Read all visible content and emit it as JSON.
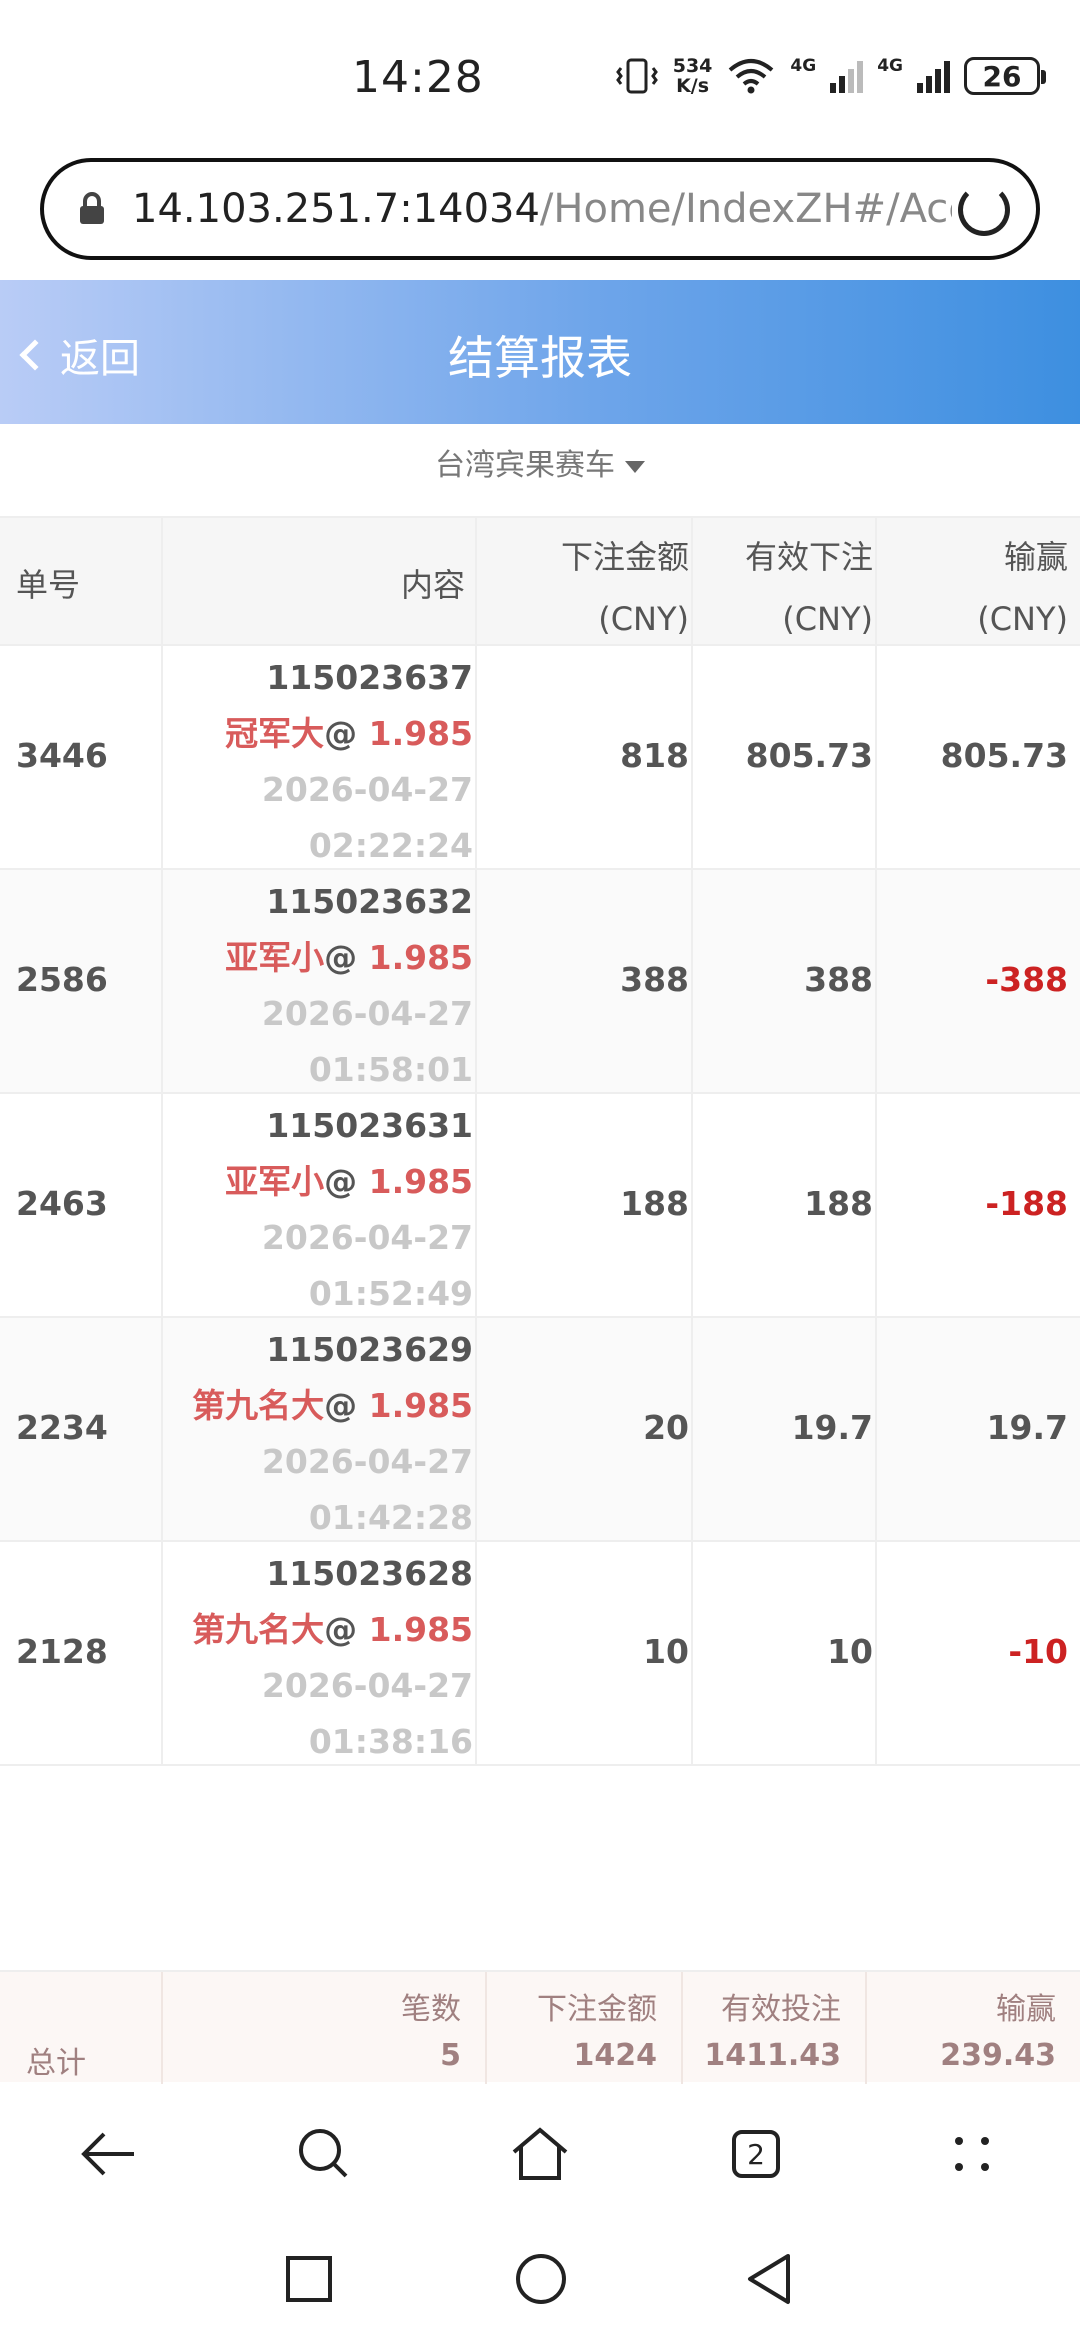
{
  "status_bar": {
    "time": "14:28",
    "net_speed_value": "534",
    "net_speed_unit": "K/s",
    "sig1_label": "4G",
    "sig2_label": "4G",
    "battery": "26"
  },
  "url_bar": {
    "host": "14.103.251.7:14034",
    "path": "/Home/IndexZH#/Acco"
  },
  "header": {
    "back_label": "返回",
    "title": "结算报表"
  },
  "game_selector": "台湾宾果赛车",
  "table": {
    "columns": [
      {
        "label": "单号",
        "unit": ""
      },
      {
        "label": "内容",
        "unit": ""
      },
      {
        "label": "下注金额",
        "unit": "(CNY)"
      },
      {
        "label": "有效下注",
        "unit": "(CNY)"
      },
      {
        "label": "输赢",
        "unit": "(CNY)"
      }
    ],
    "rows": [
      {
        "id": "3446",
        "order_no": "115023637",
        "pick": "冠军大",
        "at": "@",
        "odds": "1.985",
        "date": "2026-04-27",
        "time": "02:22:24",
        "bet": "818",
        "valid": "805.73",
        "winloss": "805.73"
      },
      {
        "id": "2586",
        "order_no": "115023632",
        "pick": "亚军小",
        "at": "@",
        "odds": "1.985",
        "date": "2026-04-27",
        "time": "01:58:01",
        "bet": "388",
        "valid": "388",
        "winloss": "-388"
      },
      {
        "id": "2463",
        "order_no": "115023631",
        "pick": "亚军小",
        "at": "@",
        "odds": "1.985",
        "date": "2026-04-27",
        "time": "01:52:49",
        "bet": "188",
        "valid": "188",
        "winloss": "-188"
      },
      {
        "id": "2234",
        "order_no": "115023629",
        "pick": "第九名大",
        "at": "@",
        "odds": "1.985",
        "date": "2026-04-27",
        "time": "01:42:28",
        "bet": "20",
        "valid": "19.7",
        "winloss": "19.7"
      },
      {
        "id": "2128",
        "order_no": "115023628",
        "pick": "第九名大",
        "at": "@",
        "odds": "1.985",
        "date": "2026-04-27",
        "time": "01:38:16",
        "bet": "10",
        "valid": "10",
        "winloss": "-10"
      }
    ]
  },
  "totals": {
    "label": "总计",
    "count_label": "笔数",
    "count": "5",
    "bet_label": "下注金额",
    "bet": "1424",
    "valid_label": "有效投注",
    "valid": "1411.43",
    "winloss_label": "输赢",
    "winloss": "239.43"
  },
  "browser_nav": {
    "tab_count": "2"
  },
  "colors": {
    "header_gradient_start": "#b9ccf6",
    "header_gradient_end": "#3d8fe0",
    "pick_red": "#d85b5b",
    "loss_red": "#cc2222"
  }
}
